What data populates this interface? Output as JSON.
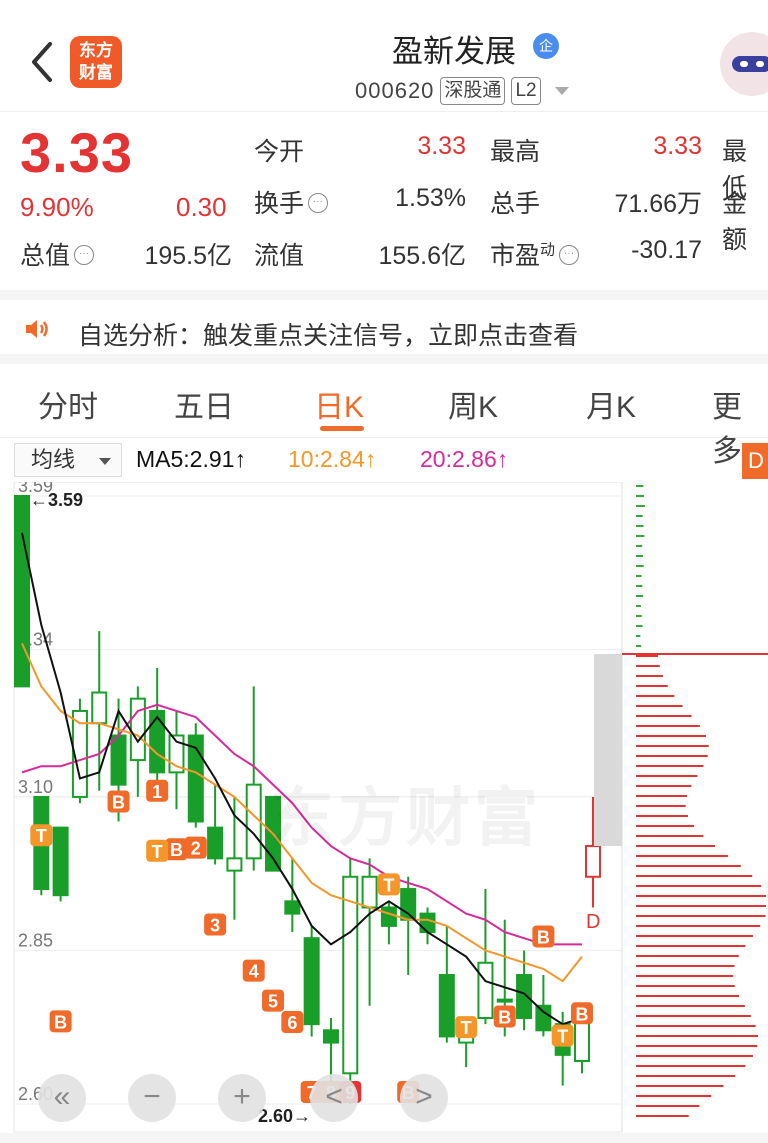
{
  "header": {
    "logo_line1": "东方",
    "logo_line2": "财富",
    "stock_name": "盈新发展",
    "badge": "企",
    "code": "000620",
    "tag_exchange": "深股通",
    "tag_level": "L2"
  },
  "quote": {
    "price": "3.33",
    "pct_change": "9.90%",
    "change": "0.30",
    "open_label": "今开",
    "open_value": "3.33",
    "high_label": "最高",
    "high_value": "3.33",
    "low_label": "最低",
    "turnover_label": "换手",
    "turnover_value": "1.53%",
    "volume_label": "总手",
    "volume_value": "71.66万",
    "amount_label": "金额",
    "mktcap_label": "总值",
    "mktcap_value": "195.5亿",
    "float_label": "流值",
    "float_value": "155.6亿",
    "pe_label": "市盈",
    "pe_sup": "动",
    "pe_value": "-30.17"
  },
  "notice": {
    "text": "自选分析：触发重点关注信号，立即点击查看"
  },
  "tabs": [
    {
      "label": "分时"
    },
    {
      "label": "五日"
    },
    {
      "label": "日K"
    },
    {
      "label": "周K"
    },
    {
      "label": "月K"
    },
    {
      "label": "更多"
    }
  ],
  "ma_bar": {
    "selector": "均线",
    "ma5": "MA5:2.91↑",
    "ma10": "10:2.84↑",
    "ma20": "20:2.86↑",
    "d_button": "D"
  },
  "colors": {
    "up": "#e33333",
    "down": "#1a9e2a",
    "accent": "#f06a2a",
    "ma5": "#111111",
    "ma10": "#f5962a",
    "ma20": "#d82a9a"
  },
  "chart": {
    "watermark": "东方财富",
    "y_ticks": [
      "3.59",
      "3.34",
      "3.10",
      "2.85",
      "2.60"
    ],
    "high_label": "←3.59",
    "low_label": "2.60→",
    "signal_numbers": [
      "1",
      "2",
      "3",
      "4",
      "5",
      "6",
      "7",
      "8",
      "9"
    ],
    "marker_b": "B",
    "marker_t": "T",
    "marker_d": "D"
  },
  "controls": {
    "rewind": "«",
    "zoom_out": "−",
    "zoom_in": "+",
    "prev": "<",
    "next": ">"
  },
  "chart_data": {
    "type": "candlestick",
    "ylim": [
      2.6,
      3.59
    ],
    "candles": [
      {
        "o": 3.59,
        "h": 3.59,
        "l": 3.28,
        "c": 3.28
      },
      {
        "o": 3.1,
        "h": 3.1,
        "l": 2.94,
        "c": 2.95
      },
      {
        "o": 3.05,
        "h": 3.05,
        "l": 2.93,
        "c": 2.94
      },
      {
        "o": 3.1,
        "h": 3.26,
        "l": 3.09,
        "c": 3.24
      },
      {
        "o": 3.22,
        "h": 3.37,
        "l": 3.11,
        "c": 3.27
      },
      {
        "o": 3.2,
        "h": 3.26,
        "l": 3.06,
        "c": 3.12
      },
      {
        "o": 3.16,
        "h": 3.28,
        "l": 3.1,
        "c": 3.26
      },
      {
        "o": 3.24,
        "h": 3.31,
        "l": 3.11,
        "c": 3.14
      },
      {
        "o": 3.14,
        "h": 3.24,
        "l": 3.08,
        "c": 3.2
      },
      {
        "o": 3.2,
        "h": 3.22,
        "l": 3.05,
        "c": 3.06
      },
      {
        "o": 3.05,
        "h": 3.12,
        "l": 2.99,
        "c": 3.0
      },
      {
        "o": 2.98,
        "h": 3.1,
        "l": 2.9,
        "c": 3.0
      },
      {
        "o": 3.0,
        "h": 3.28,
        "l": 2.98,
        "c": 3.12
      },
      {
        "o": 3.1,
        "h": 3.1,
        "l": 2.98,
        "c": 2.98
      },
      {
        "o": 2.93,
        "h": 3.0,
        "l": 2.88,
        "c": 2.91
      },
      {
        "o": 2.87,
        "h": 2.89,
        "l": 2.71,
        "c": 2.73
      },
      {
        "o": 2.72,
        "h": 2.74,
        "l": 2.63,
        "c": 2.7
      },
      {
        "o": 2.65,
        "h": 3.0,
        "l": 2.6,
        "c": 2.97
      },
      {
        "o": 2.92,
        "h": 3.0,
        "l": 2.76,
        "c": 2.97
      },
      {
        "o": 2.92,
        "h": 2.93,
        "l": 2.86,
        "c": 2.89
      },
      {
        "o": 2.95,
        "h": 2.97,
        "l": 2.81,
        "c": 2.9
      },
      {
        "o": 2.91,
        "h": 2.92,
        "l": 2.86,
        "c": 2.88
      },
      {
        "o": 2.81,
        "h": 2.89,
        "l": 2.7,
        "c": 2.71
      },
      {
        "o": 2.7,
        "h": 2.73,
        "l": 2.66,
        "c": 2.73
      },
      {
        "o": 2.74,
        "h": 2.95,
        "l": 2.73,
        "c": 2.83
      },
      {
        "o": 2.77,
        "h": 2.9,
        "l": 2.71,
        "c": 2.77
      },
      {
        "o": 2.81,
        "h": 2.85,
        "l": 2.72,
        "c": 2.74
      },
      {
        "o": 2.76,
        "h": 2.81,
        "l": 2.71,
        "c": 2.72
      },
      {
        "o": 2.73,
        "h": 2.75,
        "l": 2.63,
        "c": 2.68
      },
      {
        "o": 2.67,
        "h": 2.76,
        "l": 2.65,
        "c": 2.76
      }
    ],
    "ma5": [
      3.53,
      3.38,
      3.27,
      3.13,
      3.14,
      3.24,
      3.19,
      3.23,
      3.19,
      3.18,
      3.13,
      3.07,
      3.04,
      3.0,
      2.95,
      2.89,
      2.86,
      2.88,
      2.91,
      2.93,
      2.91,
      2.88,
      2.86,
      2.84,
      2.8,
      2.79,
      2.78,
      2.75,
      2.73,
      2.74
    ],
    "ma10": [
      3.35,
      3.28,
      3.24,
      3.22,
      3.22,
      3.21,
      3.2,
      3.17,
      3.15,
      3.14,
      3.12,
      3.1,
      3.07,
      3.04,
      3.0,
      2.96,
      2.94,
      2.93,
      2.92,
      2.91,
      2.9,
      2.9,
      2.89,
      2.87,
      2.85,
      2.84,
      2.83,
      2.82,
      2.8,
      2.84
    ],
    "ma20": [
      3.14,
      3.15,
      3.15,
      3.16,
      3.17,
      3.2,
      3.24,
      3.25,
      3.24,
      3.23,
      3.2,
      3.17,
      3.15,
      3.12,
      3.09,
      3.05,
      3.02,
      3.0,
      2.99,
      2.97,
      2.96,
      2.95,
      2.93,
      2.91,
      2.9,
      2.88,
      2.87,
      2.86,
      2.86,
      2.86
    ],
    "last_candle": {
      "o": 3.02,
      "h": 3.1,
      "l": 2.92,
      "c": 2.97,
      "color": "up"
    }
  }
}
